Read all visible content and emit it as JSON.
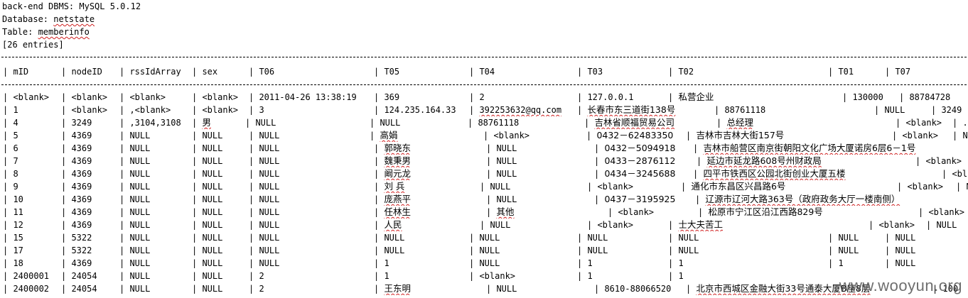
{
  "header": {
    "dbms": "back-end DBMS: MySQL 5.0.12",
    "database_label": "Database: ",
    "database_value": "netstate",
    "table_label": "Table: ",
    "table_value": "memberinfo",
    "entries": "[26 entries]"
  },
  "columns": [
    "mID",
    "nodeID",
    "rssIdArray",
    "sex",
    "T06",
    "T05",
    "T04",
    "T03",
    "T02",
    "T01",
    "T07"
  ],
  "rows": [
    [
      "<blank>",
      "<blank>",
      "<blank>",
      "<blank>",
      "2011-04-26 13:38:19",
      "369",
      "2",
      "127.0.0.1",
      "私营企业",
      "130000",
      "88784728"
    ],
    [
      "1",
      "<blank>",
      ",<blank>",
      "<blank>",
      "3",
      "124.235.164.33",
      "392253632@qq.com",
      "长春市东三道街138号",
      "88761118",
      "NULL",
      "3249"
    ],
    [
      "4",
      "3249",
      ",3104,3108",
      "男",
      "NULL",
      "NULL",
      "88761118",
      "吉林省顺福贸易公司",
      "总经理",
      "<blank>",
      "..."
    ],
    [
      "5",
      "4369",
      "NULL",
      "NULL",
      "NULL",
      "高娟",
      "<blank>",
      "0432－62483350",
      "吉林市吉林大街157号",
      "<blank>",
      "NU"
    ],
    [
      "6",
      "4369",
      "NULL",
      "NULL",
      "NULL",
      "郭晓东",
      "NULL",
      "0432－5094918",
      "吉林市船营区南京街朝阳文化广场大厦诺房6层6－1号",
      "",
      ""
    ],
    [
      "7",
      "4369",
      "NULL",
      "NULL",
      "NULL",
      "魏秉男",
      "NULL",
      "0433－2876112",
      "延边市延龙路608号州财政局",
      "<blank>",
      ""
    ],
    [
      "8",
      "4369",
      "NULL",
      "NULL",
      "NULL",
      "阚元龙",
      "NULL",
      "0434－3245688",
      "四平市铁西区公园北街创业大厦五楼",
      "<bl",
      ""
    ],
    [
      "9",
      "4369",
      "NULL",
      "NULL",
      "NULL",
      "刘 兵",
      "NULL",
      "<blank>",
      "通化市东昌区兴昌路6号",
      "<blank>",
      "N"
    ],
    [
      "10",
      "4369",
      "NULL",
      "NULL",
      "NULL",
      "庞燕平",
      "NULL",
      "0437－3195925",
      "辽源市辽河大路363号（政府政务大厅一楼南侧）",
      "<blank>",
      ""
    ],
    [
      "11",
      "4369",
      "NULL",
      "NULL",
      "NULL",
      "任林生",
      "其他",
      "<blank>",
      "松原市宁江区沿江西路829号",
      "<blank>",
      ""
    ],
    [
      "12",
      "4369",
      "NULL",
      "NULL",
      "NULL",
      "人民",
      "NULL",
      "<blank>",
      "士大夫苦工",
      "<blank>",
      "NULL"
    ],
    [
      "15",
      "5322",
      "NULL",
      "NULL",
      "NULL",
      "NULL",
      "NULL",
      "NULL",
      "NULL",
      "NULL",
      "NULL"
    ],
    [
      "17",
      "5322",
      "NULL",
      "NULL",
      "NULL",
      "NULL",
      "NULL",
      "NULL",
      "NULL",
      "NULL",
      "NULL"
    ],
    [
      "18",
      "4369",
      "NULL",
      "NULL",
      "NULL",
      "1",
      "NULL",
      "1",
      "1",
      "1",
      "NULL"
    ],
    [
      "2400001",
      "24054",
      "NULL",
      "NULL",
      "2",
      "1",
      "<blank>",
      "1",
      "1",
      "",
      ""
    ],
    [
      "2400002",
      "24054",
      "NULL",
      "NULL",
      "2",
      "王东明",
      "NULL",
      "8610-88066520",
      "北京市西城区金融大街33号通泰大厦B座8层",
      "100",
      ""
    ]
  ],
  "watermark": "www.wooyun.org"
}
